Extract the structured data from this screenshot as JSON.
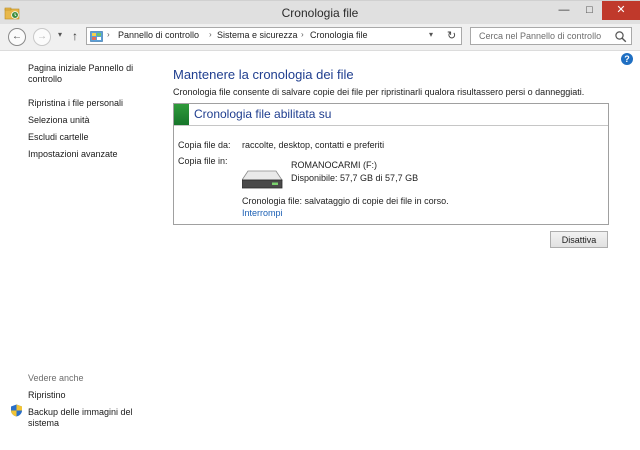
{
  "window": {
    "title": "Cronologia file",
    "controls": {
      "minimize": "—",
      "maximize": "□",
      "close": "✕"
    }
  },
  "nav": {
    "back": "←",
    "forward": "→",
    "dropdown": "▾",
    "up": "↑",
    "breadcrumb": [
      "Pannello di controllo",
      "Sistema e sicurezza",
      "Cronologia file"
    ],
    "separator": "›",
    "address_dropdown": "▾",
    "refresh": "↻",
    "search_placeholder": "Cerca nel Pannello di controllo"
  },
  "sidebar": {
    "links": [
      "Pagina iniziale Pannello di controllo",
      "Ripristina i file personali",
      "Seleziona unità",
      "Escludi cartelle",
      "Impostazioni avanzate"
    ],
    "see_also_label": "Vedere anche",
    "see_also": [
      "Ripristino",
      "Backup delle immagini del sistema"
    ]
  },
  "help": "?",
  "main": {
    "title": "Mantenere la cronologia dei file",
    "description": "Cronologia file consente di salvare copie dei file per ripristinarli qualora risultassero persi o danneggiati.",
    "panel": {
      "title": "Cronologia file abilitata su",
      "copy_from_label": "Copia file da:",
      "copy_from_value": "raccolte, desktop, contatti e preferiti",
      "copy_to_label": "Copia file in:",
      "drive_name": "ROMANOCARMI (F:)",
      "drive_space": "Disponibile: 57,7 GB di 57,7 GB",
      "status": "Cronologia file: salvataggio di copie dei file in corso.",
      "stop_link": "Interrompi"
    },
    "disable_button": "Disattiva"
  },
  "colors": {
    "title_blue": "#1f3e8f",
    "link_blue": "#1a5fb4",
    "status_green": "#2f9b3b",
    "close_red": "#c0392b"
  },
  "icons": [
    "folder-icon",
    "back-arrow-icon",
    "forward-arrow-icon",
    "up-arrow-icon",
    "control-panel-icon",
    "refresh-icon",
    "search-icon",
    "help-icon",
    "shield-icon",
    "drive-icon"
  ]
}
